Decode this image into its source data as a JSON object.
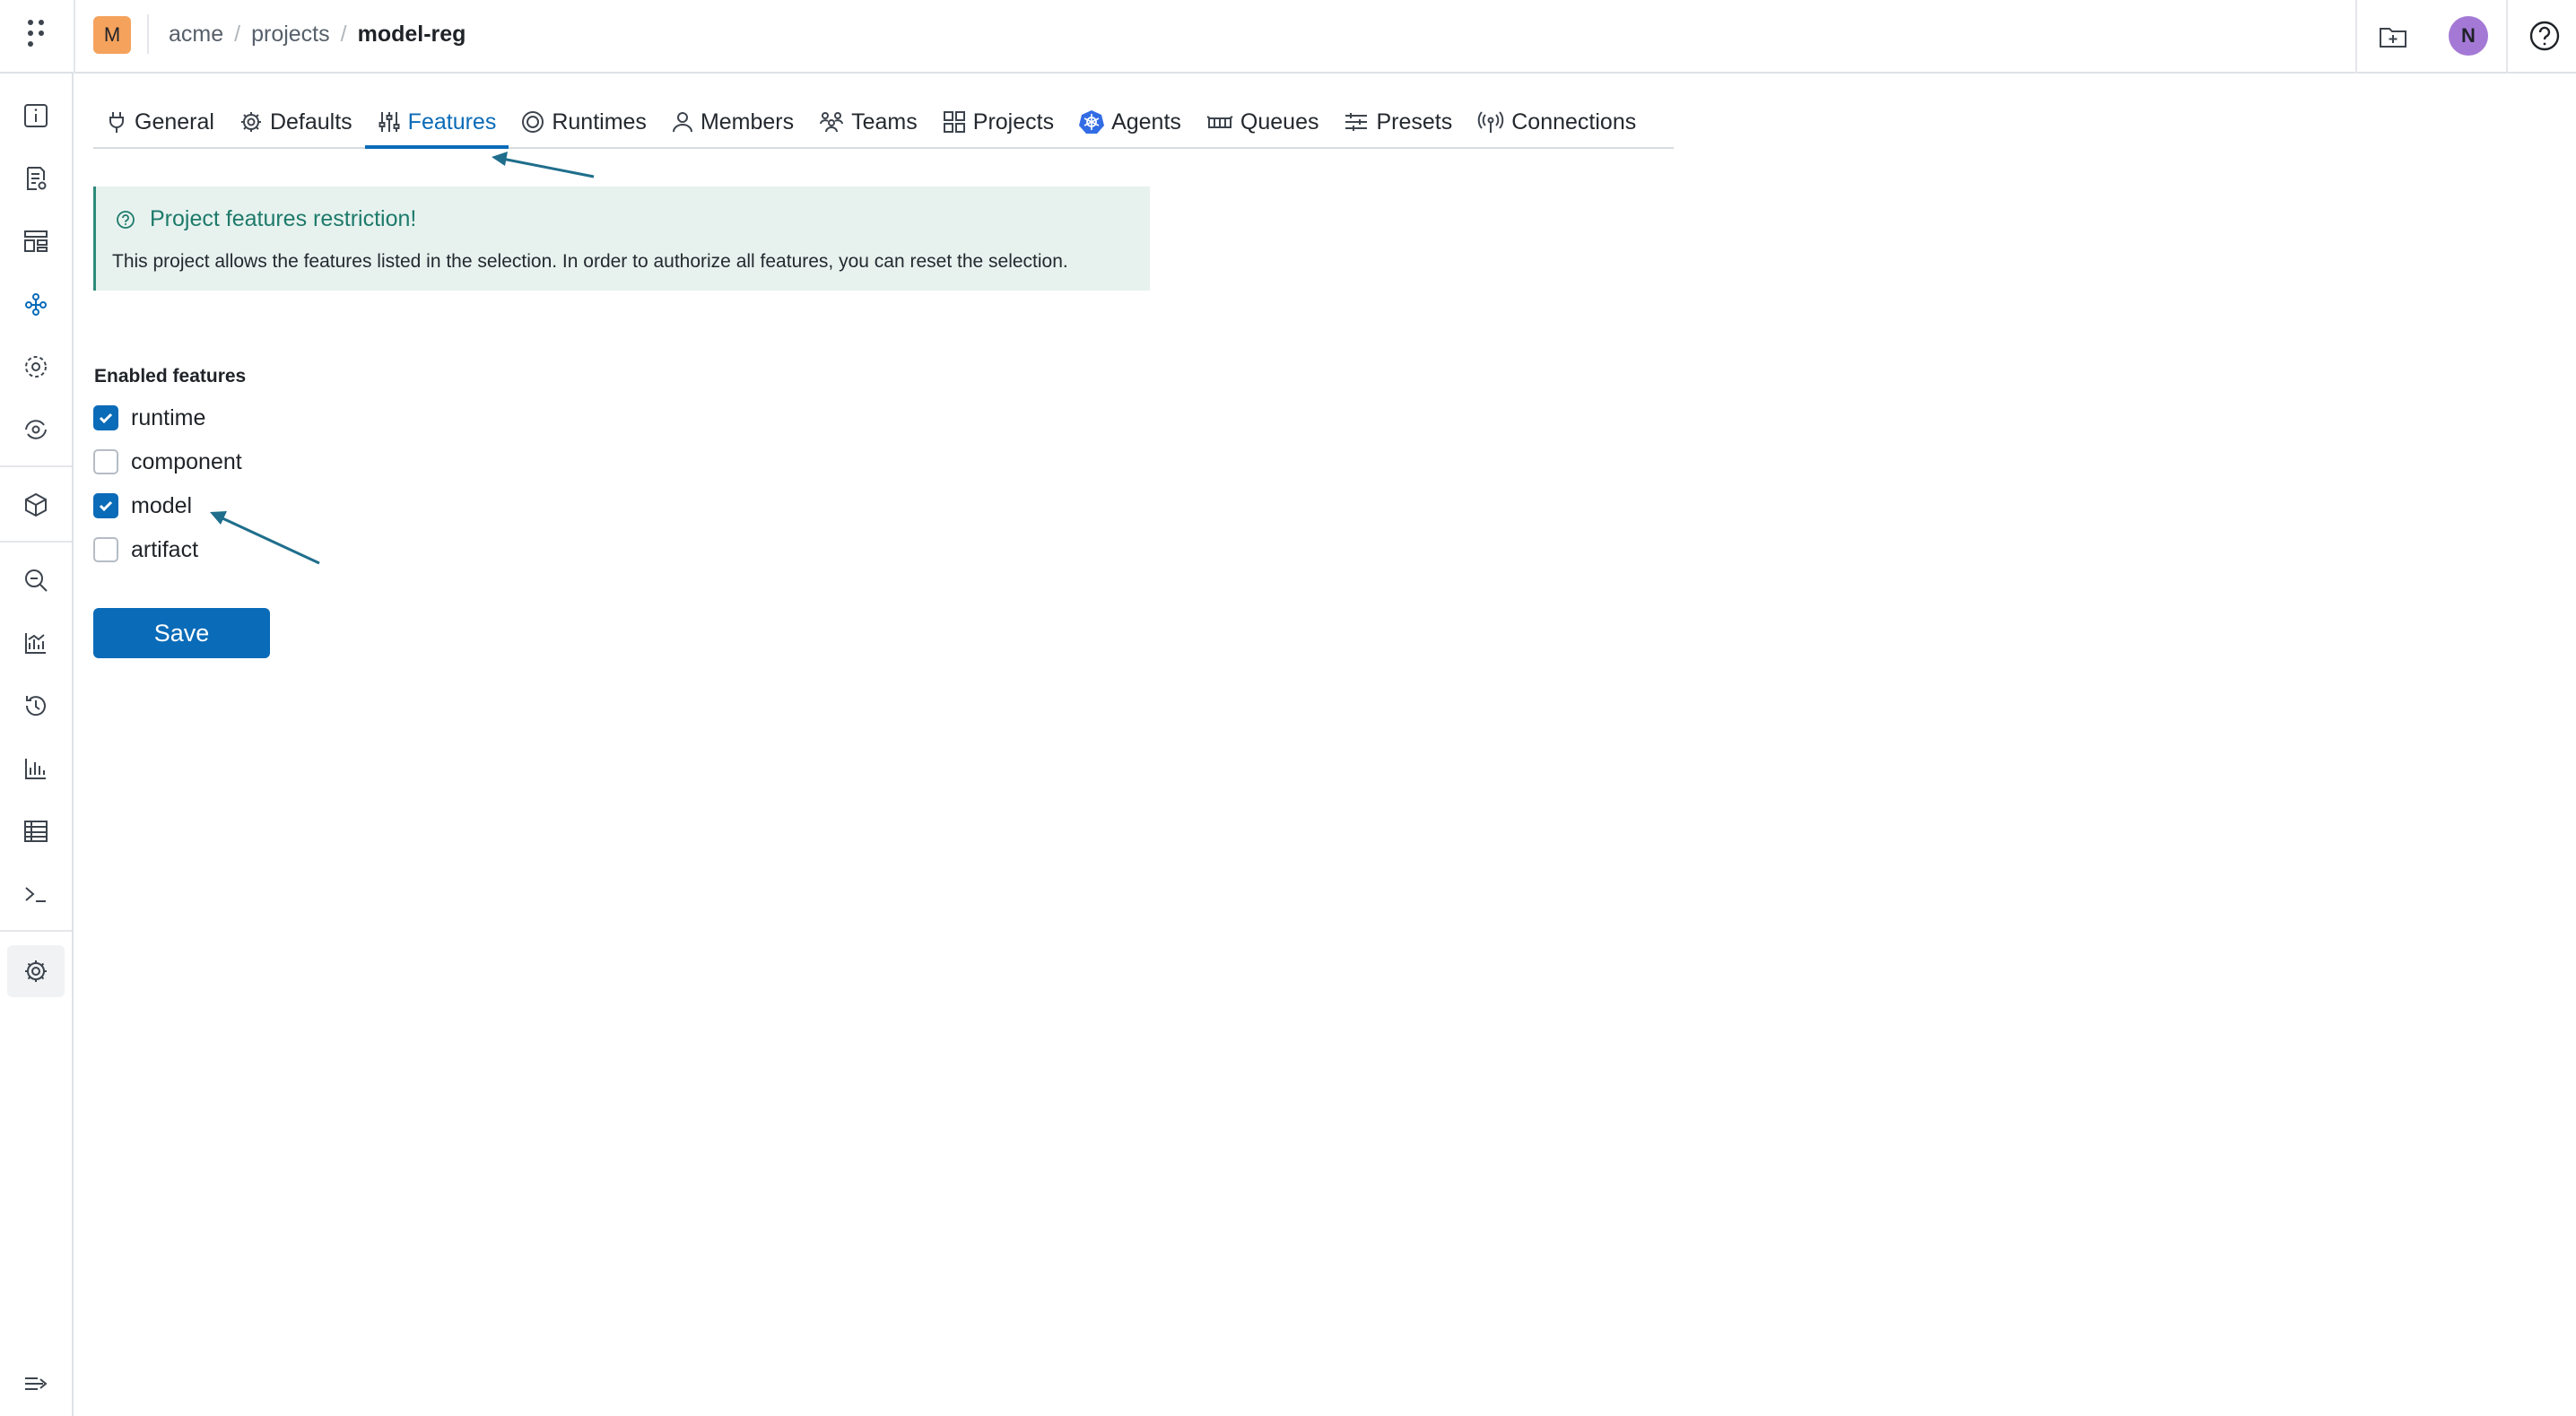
{
  "header": {
    "project_badge": "M",
    "breadcrumb": [
      "acme",
      "projects",
      "model-reg"
    ],
    "breadcrumb_sep": "/",
    "avatar_initial": "N"
  },
  "tabs": [
    {
      "label": "General",
      "icon": "plug-icon"
    },
    {
      "label": "Defaults",
      "icon": "gear-icon"
    },
    {
      "label": "Features",
      "icon": "sliders-icon",
      "active": true
    },
    {
      "label": "Runtimes",
      "icon": "target-icon"
    },
    {
      "label": "Members",
      "icon": "user-icon"
    },
    {
      "label": "Teams",
      "icon": "team-icon"
    },
    {
      "label": "Projects",
      "icon": "grid-icon"
    },
    {
      "label": "Agents",
      "icon": "kubernetes-icon"
    },
    {
      "label": "Queues",
      "icon": "queue-icon"
    },
    {
      "label": "Presets",
      "icon": "presets-icon"
    },
    {
      "label": "Connections",
      "icon": "antenna-icon"
    }
  ],
  "callout": {
    "title": "Project features restriction!",
    "body": "This project allows the features listed in the selection. In order to authorize all features, you can reset the selection."
  },
  "features": {
    "label": "Enabled features",
    "items": [
      {
        "label": "runtime",
        "checked": true
      },
      {
        "label": "component",
        "checked": false
      },
      {
        "label": "model",
        "checked": true
      },
      {
        "label": "artifact",
        "checked": false
      }
    ],
    "save_label": "Save"
  },
  "colors": {
    "accent": "#0a6bb8",
    "callout_bg": "#e7f2ef",
    "callout_text": "#1d7a6a",
    "badge": "#f5a25d",
    "avatar": "#a479d6",
    "annotation_arrow": "#1f6e8c"
  }
}
